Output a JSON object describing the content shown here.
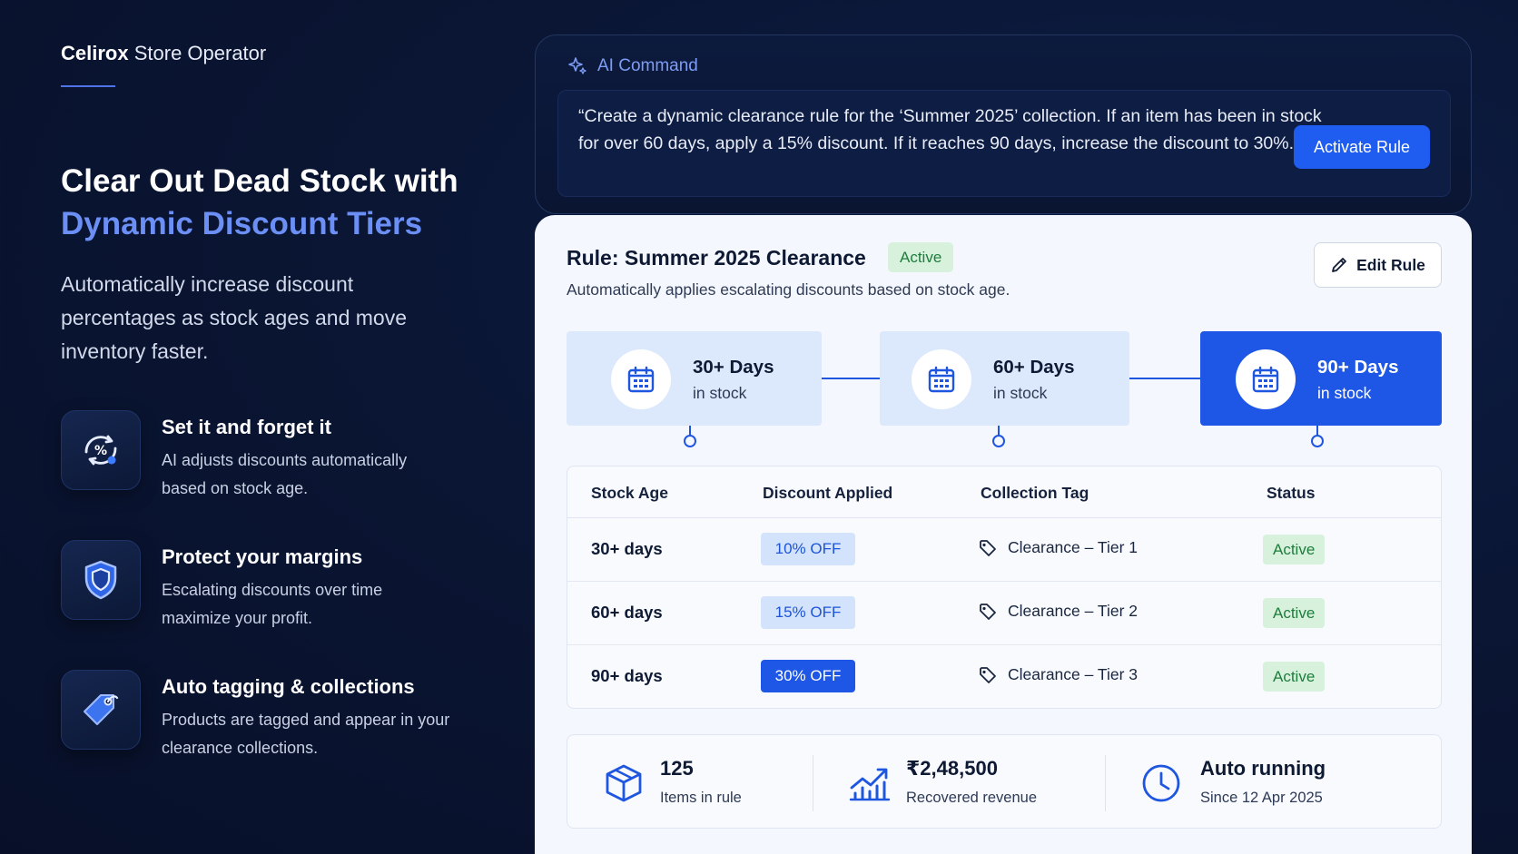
{
  "brand": {
    "name": "Celirox",
    "product": "Store Operator"
  },
  "hero": {
    "title_line1": "Clear Out Dead Stock with",
    "title_line2": "Dynamic Discount Tiers",
    "subtitle": "Automatically increase discount percentages as stock ages and move inventory faster."
  },
  "features": [
    {
      "title": "Set it and forget it",
      "desc": "AI adjusts discounts automatically based on stock age.",
      "icon": "percent-refresh-icon"
    },
    {
      "title": "Protect your margins",
      "desc": "Escalating discounts over time maximize your profit.",
      "icon": "shield-icon"
    },
    {
      "title": "Auto tagging & collections",
      "desc": "Products are tagged and appear in your clearance collections.",
      "icon": "tag-icon"
    }
  ],
  "command": {
    "label": "AI Command",
    "text": "“Create a dynamic clearance rule for the ‘Summer 2025’ collection. If an item has been in stock for over 60 days, apply a 15% discount. If it reaches 90 days, increase the discount to 30%.”.”",
    "button": "Activate Rule"
  },
  "rule": {
    "title": "Rule: Summer 2025 Clearance",
    "badge": "Active",
    "description": "Automatically applies escalating discounts based on stock age.",
    "edit_label": "Edit Rule"
  },
  "tiers": [
    {
      "days": "30+ Days",
      "sub": "in stock",
      "active": false
    },
    {
      "days": "60+ Days",
      "sub": "in stock",
      "active": false
    },
    {
      "days": "90+ Days",
      "sub": "in stock",
      "active": true
    }
  ],
  "table": {
    "headers": [
      "Stock Age",
      "Discount Applied",
      "Collection Tag",
      "Status"
    ],
    "rows": [
      {
        "age": "30+ days",
        "discount": "10% OFF",
        "tag": "Clearance – Tier 1",
        "status": "Active"
      },
      {
        "age": "60+ days",
        "discount": "15% OFF",
        "tag": "Clearance – Tier 2",
        "status": "Active"
      },
      {
        "age": "90+ days",
        "discount": "30% OFF",
        "tag": "Clearance – Tier 3",
        "status": "Active"
      }
    ]
  },
  "stats": [
    {
      "value": "125",
      "label": "Items in rule",
      "icon": "box-icon"
    },
    {
      "value": "₹2,48,500",
      "label": "Recovered revenue",
      "icon": "chart-growth-icon"
    },
    {
      "value": "Auto running",
      "label": "Since 12 Apr 2025",
      "icon": "clock-icon"
    }
  ],
  "colors": {
    "accent": "#1f5cf0",
    "accent_light": "#6b8ff5",
    "success": "#1e7d3c",
    "success_bg": "#d7f1dc",
    "background": "#0a1634"
  }
}
